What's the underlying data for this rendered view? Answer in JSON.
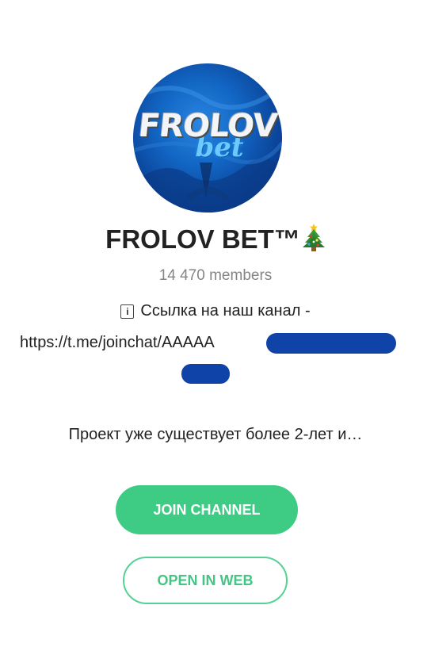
{
  "channel": {
    "avatar": {
      "logo_main": "FROLOV",
      "logo_sub": "bet"
    },
    "title": "FROLOV BET™",
    "title_emoji": "christmas-tree-icon",
    "members": "14 470 members",
    "description": {
      "info_icon": "i",
      "line1": "Ссылка на наш канал -",
      "line2": "https://t.me/joinchat/AAAAA",
      "line3": "Проект уже существует более 2-лет и…"
    }
  },
  "actions": {
    "join_label": "JOIN CHANNEL",
    "web_label": "OPEN IN WEB"
  },
  "colors": {
    "accent": "#3ecb83",
    "redaction": "#0f43a8",
    "muted_text": "#858585"
  }
}
